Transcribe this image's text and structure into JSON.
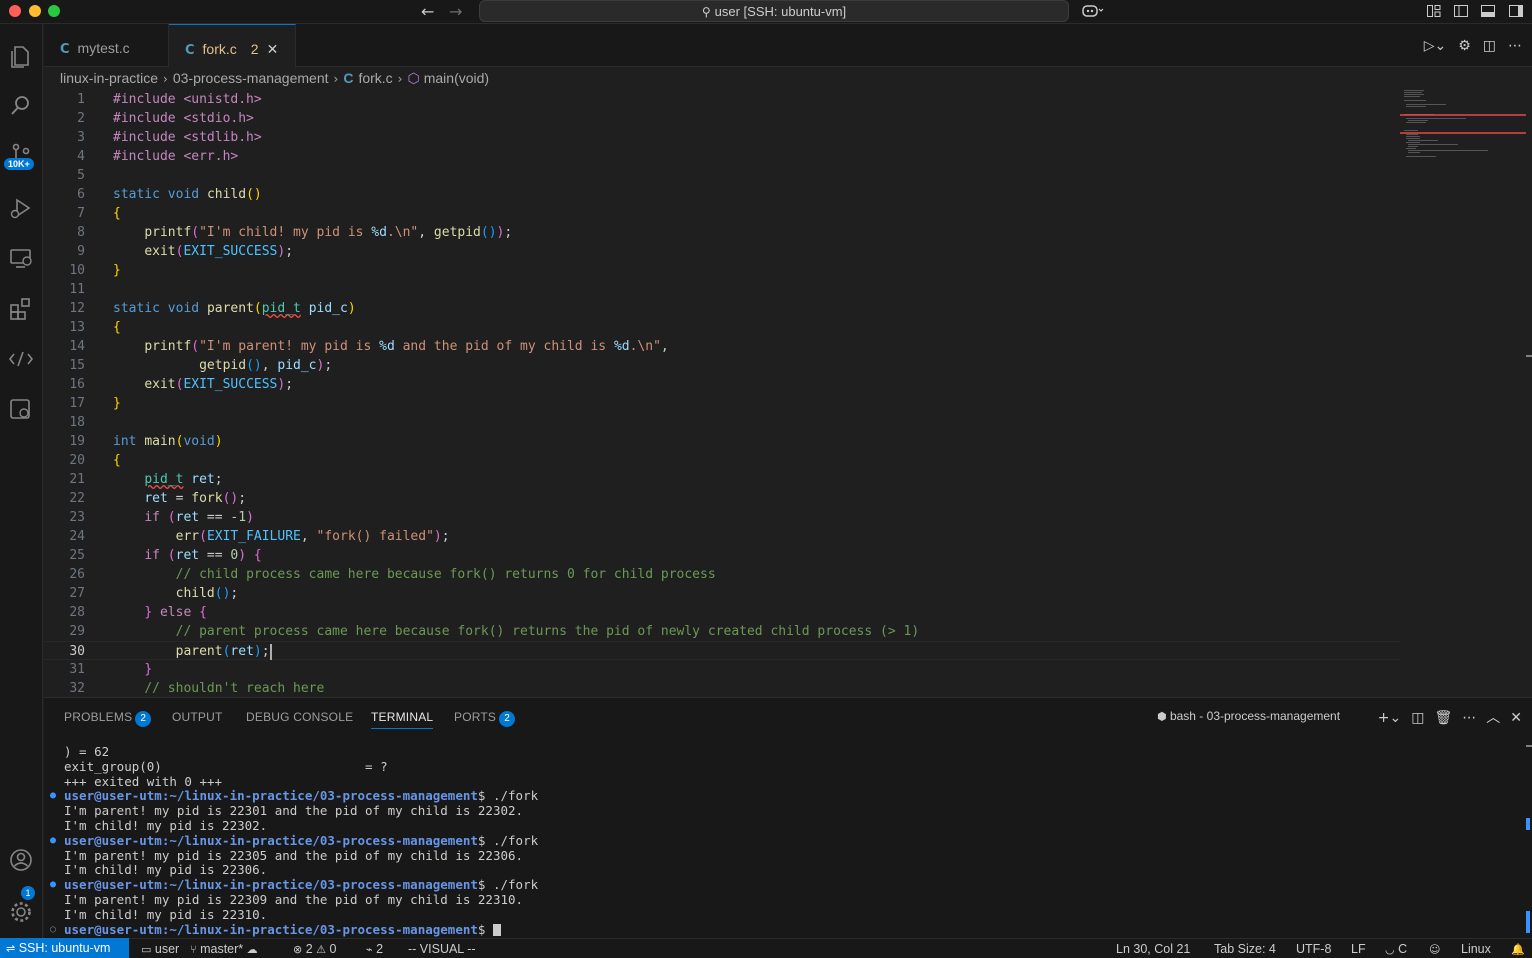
{
  "window": {
    "command_center": "user [SSH: ubuntu-vm]"
  },
  "activity": {
    "source_control_badge": "10K+",
    "accounts_badge": "1"
  },
  "tabs": [
    {
      "label": "mytest.c",
      "icon": "c-file-icon"
    },
    {
      "label": "fork.c",
      "icon": "c-file-icon",
      "problems": "2"
    }
  ],
  "breadcrumb": {
    "parts": [
      "linux-in-practice",
      "03-process-management",
      "fork.c",
      "main(void)"
    ]
  },
  "editor": {
    "current_line": 30,
    "lines": [
      {
        "n": "1"
      },
      {
        "n": "2"
      },
      {
        "n": "3"
      },
      {
        "n": "4"
      },
      {
        "n": "5"
      },
      {
        "n": "6"
      },
      {
        "n": "7"
      },
      {
        "n": "8"
      },
      {
        "n": "9"
      },
      {
        "n": "10"
      },
      {
        "n": "11"
      },
      {
        "n": "12"
      },
      {
        "n": "13"
      },
      {
        "n": "14"
      },
      {
        "n": "15"
      },
      {
        "n": "16"
      },
      {
        "n": "17"
      },
      {
        "n": "18"
      },
      {
        "n": "19"
      },
      {
        "n": "20"
      },
      {
        "n": "21"
      },
      {
        "n": "22"
      },
      {
        "n": "23"
      },
      {
        "n": "24"
      },
      {
        "n": "25"
      },
      {
        "n": "26"
      },
      {
        "n": "27"
      },
      {
        "n": "28"
      },
      {
        "n": "29"
      },
      {
        "n": "30"
      },
      {
        "n": "31"
      },
      {
        "n": "32"
      }
    ],
    "code": {
      "inc1": "#include <unistd.h>",
      "inc2": "#include <stdio.h>",
      "inc3": "#include <stdlib.h>",
      "inc4": "#include <err.h>",
      "static": "static",
      "void": "void",
      "int": "int",
      "child": "child",
      "parent": "parent",
      "main": "main",
      "printf": "printf",
      "getpid": "getpid",
      "exit": "exit",
      "fork": "fork",
      "err": "err",
      "pid_t": "pid_t",
      "pid_c": "pid_c",
      "ret": "ret",
      "if": "if",
      "else": "else",
      "EXIT_SUCCESS": "EXIT_SUCCESS",
      "EXIT_FAILURE": "EXIT_FAILURE",
      "str_child_a": "\"I'm child! my pid is ",
      "str_child_b": ".\\n\"",
      "str_parent_a": "\"I'm parent! my pid is ",
      "str_parent_b": " and the pid of my child is ",
      "str_parent_c": ".\\n\"",
      "fmt_d": "%d",
      "str_fork_failed": "\"fork() failed\"",
      "num_neg1": "-1",
      "num_0": "0",
      "cmt_child": "// child process came here because fork() returns 0 for child process",
      "cmt_parent": "// parent process came here because fork() returns the pid of newly created child process (> 1)",
      "cmt_reach": "// shouldn't reach here"
    }
  },
  "panel": {
    "tabs": [
      {
        "label": "PROBLEMS",
        "badge": "2"
      },
      {
        "label": "OUTPUT"
      },
      {
        "label": "DEBUG CONSOLE"
      },
      {
        "label": "TERMINAL"
      },
      {
        "label": "PORTS",
        "badge": "2"
      }
    ],
    "terminal_name": "bash - 03-process-management",
    "terminal": {
      "l1": ") = 62",
      "l2": "exit_group(0)                           = ?",
      "l3": "+++ exited with 0 +++",
      "prompt": "user@user-utm:~/linux-in-practice/03-process-management",
      "cmd": "$ ./fork",
      "last": "$ ",
      "r1a": "I'm parent! my pid is 22301 and the pid of my child is 22302.",
      "r1b": "I'm child! my pid is 22302.",
      "r2a": "I'm parent! my pid is 22305 and the pid of my child is 22306.",
      "r2b": "I'm child! my pid is 22306.",
      "r3a": "I'm parent! my pid is 22309 and the pid of my child is 22310.",
      "r3b": "I'm child! my pid is 22310."
    }
  },
  "status": {
    "remote": "SSH: ubuntu-vm",
    "user": "user",
    "branch": "master*",
    "errors": "2",
    "warnings": "0",
    "ports": "2",
    "mode": "-- VISUAL --",
    "position": "Ln 30, Col 21",
    "tab_size": "Tab Size: 4",
    "encoding": "UTF-8",
    "eol": "LF",
    "language": "C",
    "platform": "Linux"
  }
}
